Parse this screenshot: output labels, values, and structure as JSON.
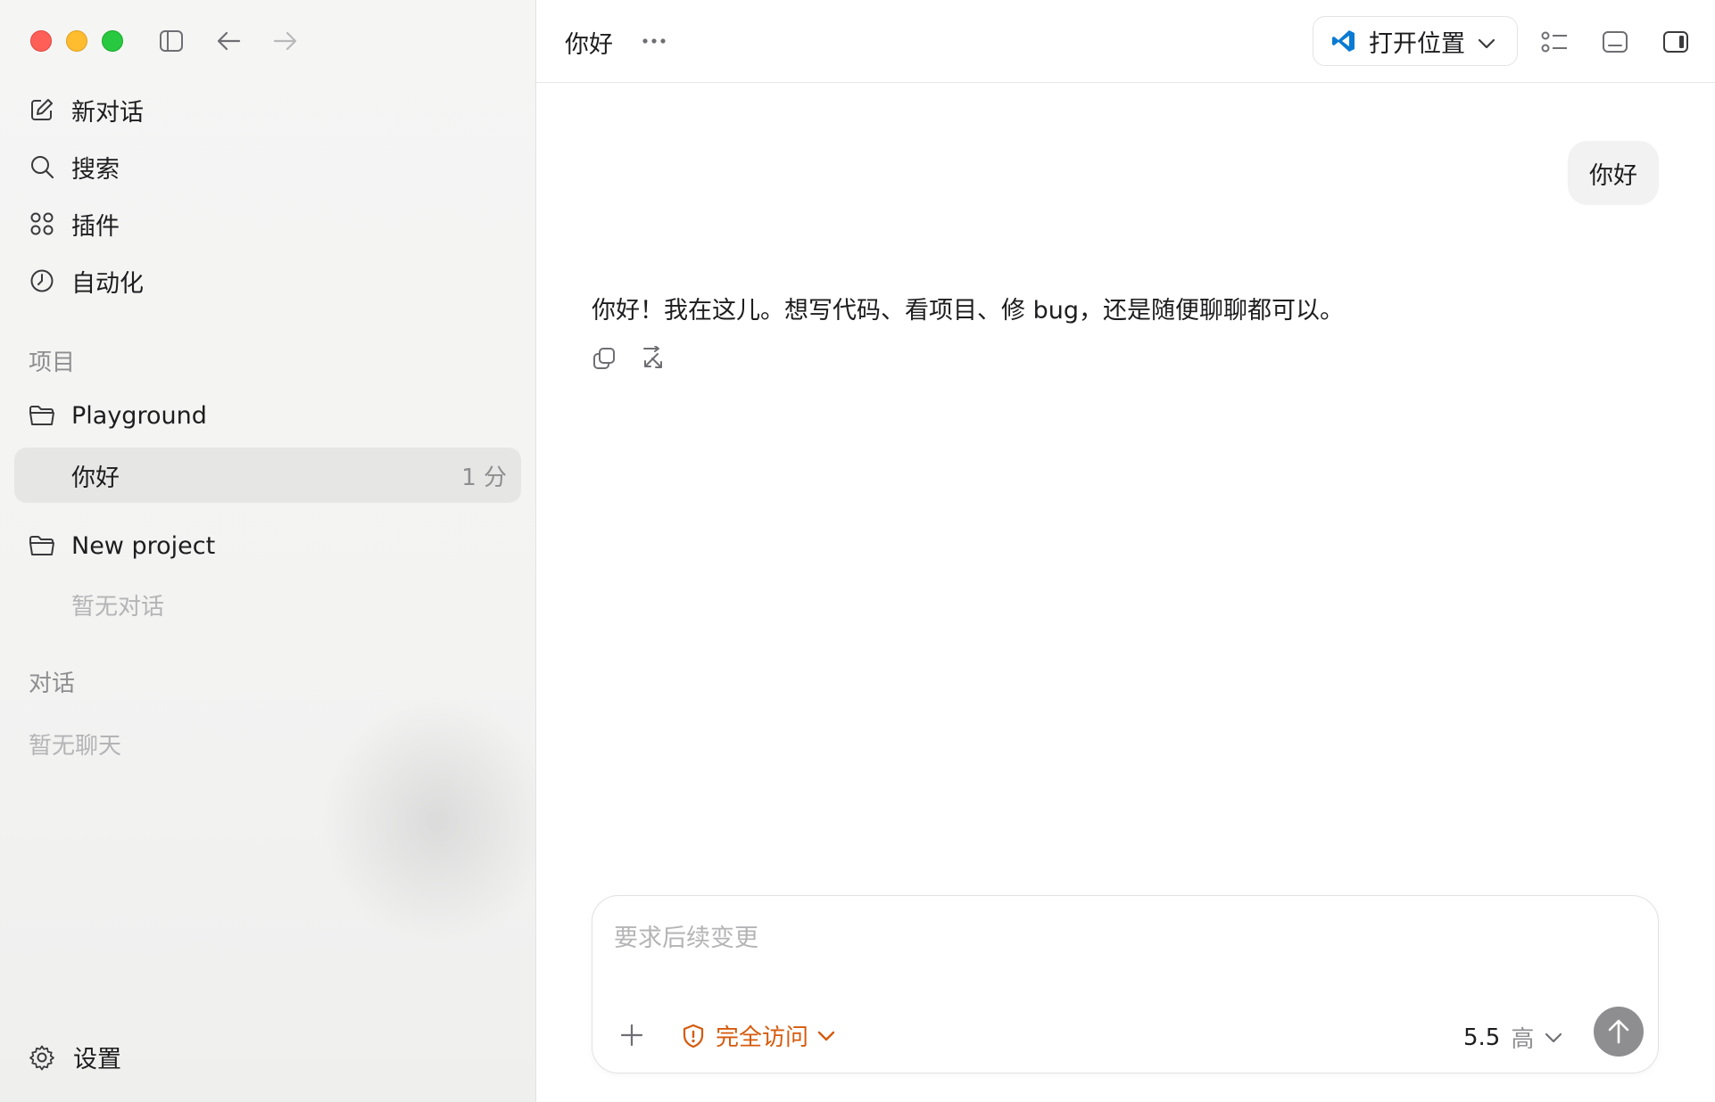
{
  "window": {
    "controls": [
      "close",
      "minimize",
      "zoom"
    ]
  },
  "sidebar": {
    "nav": [
      {
        "label": "新对话",
        "icon": "edit-icon"
      },
      {
        "label": "搜索",
        "icon": "search-icon"
      },
      {
        "label": "插件",
        "icon": "grid-icon"
      },
      {
        "label": "自动化",
        "icon": "clock-icon"
      }
    ],
    "projects_label": "项目",
    "projects": [
      {
        "name": "Playground",
        "threads": [
          {
            "title": "你好",
            "time": "1 分"
          }
        ]
      },
      {
        "name": "New project",
        "empty": "暂无对话"
      }
    ],
    "chats_label": "对话",
    "chats_empty": "暂无聊天",
    "settings_label": "设置"
  },
  "header": {
    "title": "你好",
    "open_label": "打开位置",
    "colors": {
      "vscode": "#0a7bd4"
    }
  },
  "conversation": {
    "user_message": "你好",
    "assistant_message": "你好！我在这儿。想写代码、看项目、修 bug，还是随便聊聊都可以。"
  },
  "composer": {
    "placeholder": "要求后续变更",
    "access_label": "完全访问",
    "model": "5.5",
    "effort": "高",
    "colors": {
      "access": "#d65a0c",
      "send": "#8e8e90"
    }
  }
}
